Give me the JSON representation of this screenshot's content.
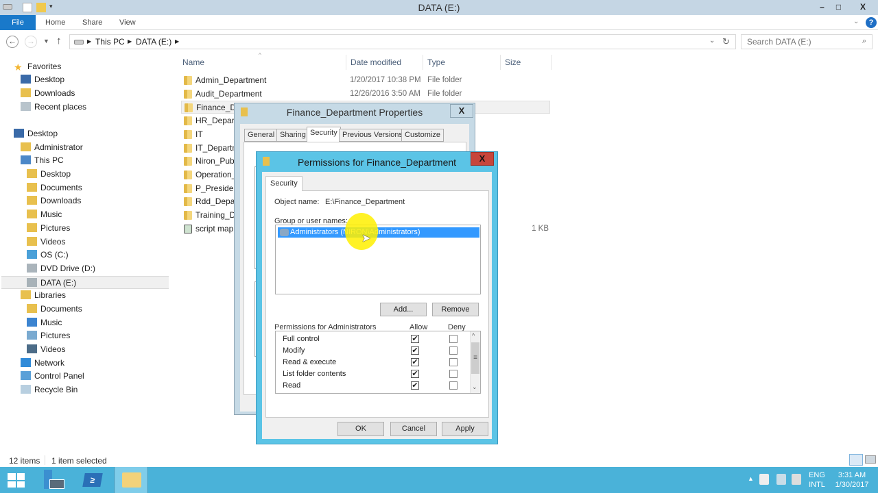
{
  "window": {
    "title": "DATA (E:)",
    "minimize": "–",
    "maximize": "□",
    "close": "X"
  },
  "ribbon": {
    "tabs": [
      "File",
      "Home",
      "Share",
      "View"
    ]
  },
  "address": {
    "crumbs": [
      "This PC",
      "DATA (E:)"
    ],
    "search_placeholder": "Search DATA (E:)"
  },
  "sidebar": {
    "items": [
      {
        "label": "Favorites",
        "icon": "star-icon",
        "level": 0
      },
      {
        "label": "Desktop",
        "icon": "desktop-icon",
        "level": 1
      },
      {
        "label": "Downloads",
        "icon": "downloads-icon",
        "level": 1
      },
      {
        "label": "Recent places",
        "icon": "recent-places-icon",
        "level": 1
      },
      {
        "label": "Desktop",
        "icon": "desktop-icon",
        "level": 0
      },
      {
        "label": "Administrator",
        "icon": "user-folder-icon",
        "level": 1
      },
      {
        "label": "This PC",
        "icon": "computer-icon",
        "level": 1
      },
      {
        "label": "Desktop",
        "icon": "desktop-folder-icon",
        "level": 2
      },
      {
        "label": "Documents",
        "icon": "documents-icon",
        "level": 2
      },
      {
        "label": "Downloads",
        "icon": "downloads-icon",
        "level": 2
      },
      {
        "label": "Music",
        "icon": "music-folder-icon",
        "level": 2
      },
      {
        "label": "Pictures",
        "icon": "pictures-folder-icon",
        "level": 2
      },
      {
        "label": "Videos",
        "icon": "videos-folder-icon",
        "level": 2
      },
      {
        "label": "OS (C:)",
        "icon": "os-drive-icon",
        "level": 2
      },
      {
        "label": "DVD Drive (D:)",
        "icon": "dvd-drive-icon",
        "level": 2
      },
      {
        "label": "DATA (E:)",
        "icon": "drive-icon",
        "level": 2,
        "selected": true
      },
      {
        "label": "Libraries",
        "icon": "libraries-icon",
        "level": 1
      },
      {
        "label": "Documents",
        "icon": "documents-icon",
        "level": 2
      },
      {
        "label": "Music",
        "icon": "music-icon",
        "level": 2
      },
      {
        "label": "Pictures",
        "icon": "pictures-icon",
        "level": 2
      },
      {
        "label": "Videos",
        "icon": "videos-icon",
        "level": 2
      },
      {
        "label": "Network",
        "icon": "network-icon",
        "level": 1
      },
      {
        "label": "Control Panel",
        "icon": "control-panel-icon",
        "level": 1
      },
      {
        "label": "Recycle Bin",
        "icon": "recycle-bin-icon",
        "level": 1
      }
    ]
  },
  "filelist": {
    "columns": [
      "Name",
      "Date modified",
      "Type",
      "Size"
    ],
    "rows": [
      {
        "name": "Admin_Department",
        "date": "1/20/2017 10:38 PM",
        "type": "File folder",
        "size": ""
      },
      {
        "name": "Audit_Department",
        "date": "12/26/2016 3:50 AM",
        "type": "File folder",
        "size": ""
      },
      {
        "name": "Finance_De",
        "date": "",
        "type": "",
        "size": "",
        "selected": true
      },
      {
        "name": "HR_Departr",
        "date": "",
        "type": "",
        "size": ""
      },
      {
        "name": "IT",
        "date": "",
        "type": "",
        "size": ""
      },
      {
        "name": "IT_Departm",
        "date": "",
        "type": "",
        "size": ""
      },
      {
        "name": "Niron_Publ",
        "date": "",
        "type": "",
        "size": ""
      },
      {
        "name": "Operation_",
        "date": "",
        "type": "",
        "size": ""
      },
      {
        "name": "P_President",
        "date": "",
        "type": "",
        "size": ""
      },
      {
        "name": "Rdd_Depart",
        "date": "",
        "type": "",
        "size": ""
      },
      {
        "name": "Training_D",
        "date": "",
        "type": "",
        "size": ""
      },
      {
        "name": "script map",
        "date": "",
        "type": "",
        "size": "1 KB",
        "script": true
      }
    ]
  },
  "status": {
    "items": "12 items",
    "selected": "1 item selected"
  },
  "properties_dialog": {
    "title": "Finance_Department Properties",
    "close": "X",
    "tabs": [
      "General",
      "Sharing",
      "Security",
      "Previous Versions",
      "Customize"
    ],
    "active_tab": "Security"
  },
  "permissions_dialog": {
    "title": "Permissions for Finance_Department",
    "close": "X",
    "tab": "Security",
    "object_name_label": "Object name:",
    "object_name_value": "E:\\Finance_Department",
    "group_label": "Group or user names:",
    "groups": [
      "Administrators (NIRON\\Administrators)"
    ],
    "add_button": "Add...",
    "remove_button": "Remove",
    "perm_label": "Permissions for Administrators",
    "allow_label": "Allow",
    "deny_label": "Deny",
    "permissions": [
      {
        "name": "Full control",
        "allow": true,
        "deny": false
      },
      {
        "name": "Modify",
        "allow": true,
        "deny": false
      },
      {
        "name": "Read & execute",
        "allow": true,
        "deny": false
      },
      {
        "name": "List folder contents",
        "allow": true,
        "deny": false
      },
      {
        "name": "Read",
        "allow": true,
        "deny": false
      }
    ],
    "ok": "OK",
    "cancel": "Cancel",
    "apply": "Apply"
  },
  "taskbar": {
    "lang_top": "ENG",
    "lang_bottom": "INTL",
    "time": "3:31 AM",
    "date": "1/30/2017"
  },
  "colors": {
    "accent": "#1979ca",
    "taskbar": "#4ab2d9",
    "dialog_frame": "#5bc4e6",
    "selection": "#3399ff",
    "close_red": "#c7453b"
  }
}
